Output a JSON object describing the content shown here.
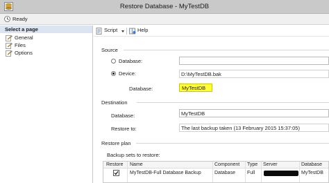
{
  "window": {
    "title": "Restore Database - MyTestDB"
  },
  "status": {
    "text": "Ready"
  },
  "left_pane": {
    "header": "Select a page",
    "pages": [
      {
        "label": "General"
      },
      {
        "label": "Files"
      },
      {
        "label": "Options"
      }
    ]
  },
  "toolbar": {
    "script_label": "Script",
    "help_label": "Help"
  },
  "source": {
    "section_label": "Source",
    "database_option_label": "Database:",
    "database_option_value": "",
    "device_option_label": "Device:",
    "device_value": "D:\\MyTestDB.bak",
    "selected_option": "device",
    "database_label": "Database:",
    "database_value": "MyTestDB"
  },
  "destination": {
    "section_label": "Destination",
    "database_label": "Database:",
    "database_value": "MyTestDB",
    "restore_to_label": "Restore to:",
    "restore_to_value": "The last backup taken (13 February 2015 15:37:05)"
  },
  "restore_plan": {
    "section_label": "Restore plan",
    "backup_sets_label": "Backup sets to restore:",
    "columns": [
      "Restore",
      "Name",
      "Component",
      "Type",
      "Server",
      "Database"
    ],
    "rows": [
      {
        "restore_checked": true,
        "name": "MyTestDB-Full Database Backup",
        "component": "Database",
        "type": "Full",
        "server": "",
        "database": "MyTestDB"
      }
    ]
  },
  "colors": {
    "highlight": "#ffff33",
    "left_header_bg": "#dbe4f0",
    "titlebar_bg": "#c9c9c9"
  }
}
